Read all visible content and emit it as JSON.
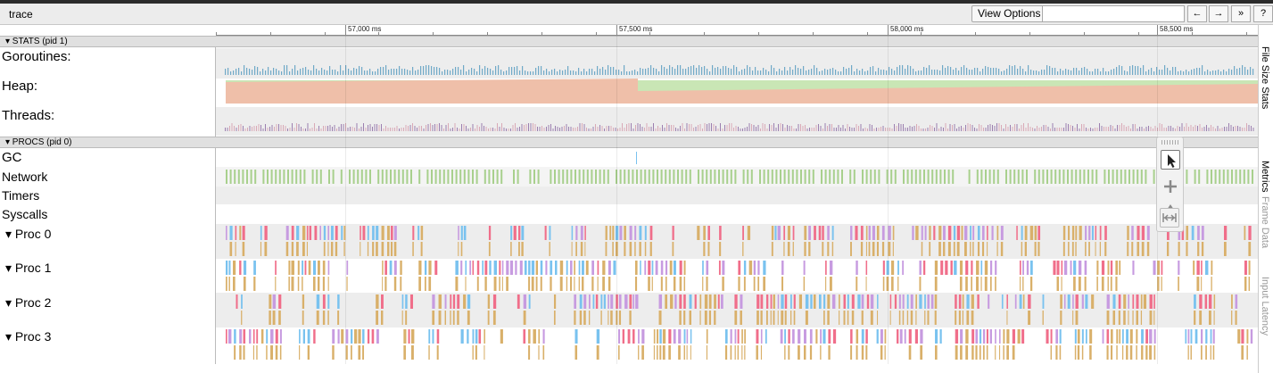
{
  "toolbar": {
    "title": "trace",
    "view_options_label": "View Options",
    "search_placeholder": "",
    "prev_label": "←",
    "next_label": "→",
    "more_label": "»",
    "help_label": "?"
  },
  "ruler": {
    "ticks": [
      "57,000 ms",
      "57,500 ms",
      "58,000 ms",
      "58,500 ms"
    ]
  },
  "sections": {
    "stats": "▾ STATS (pid 1)",
    "procs": "▾ PROCS (pid 0)"
  },
  "tracks": {
    "goroutines": "Goroutines:",
    "heap": "Heap:",
    "threads": "Threads:",
    "gc": "GC",
    "network": "Network",
    "timers": "Timers",
    "syscalls": "Syscalls",
    "proc0": "▾  Proc 0",
    "proc1": "▾  Proc 1",
    "proc2": "▾  Proc 2",
    "proc3": "▾  Proc 3"
  },
  "sidebar_tabs": [
    "File Size Stats",
    "Metrics",
    "Frame Data",
    "Input Latency"
  ],
  "tools": [
    "pointer-icon",
    "pan-icon",
    "zoom-icon",
    "timing-icon"
  ],
  "colors": {
    "heap_alloc": "#efbfa9",
    "heap_next_gc": "#c9e6b5",
    "network": "#a8d08d",
    "goroutines": "#6fa9c7",
    "threads": "#9c7fb0",
    "proc_palette": [
      "#f06e8a",
      "#79c2ef",
      "#c79be0",
      "#d9b06a",
      "#e8a0b8",
      "#b9c477"
    ]
  }
}
